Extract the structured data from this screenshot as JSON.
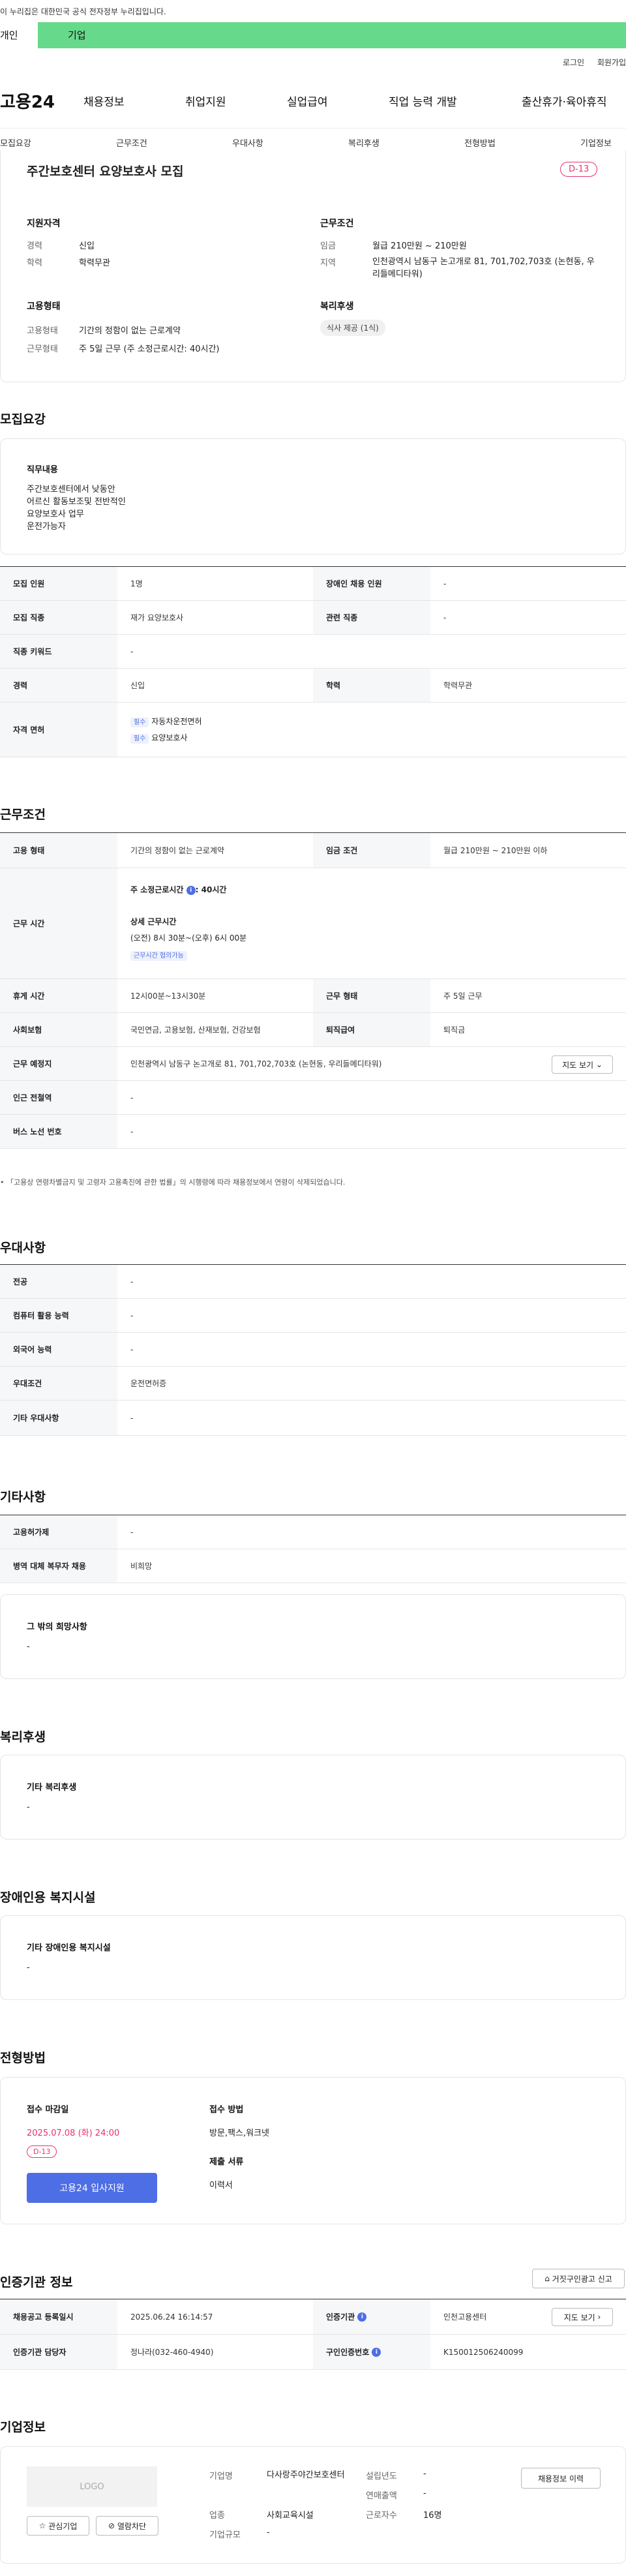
{
  "gov_banner": "이 누리집은 대한민국 공식 전자정부 누리집입니다.",
  "user_tabs": {
    "personal": "개인",
    "company": "기업"
  },
  "top_links": {
    "login": "로그인",
    "join": "회원가입"
  },
  "logo": "고용24",
  "gnb": [
    "채용정보",
    "취업지원",
    "실업급여",
    "직업 능력 개발",
    "출산휴가·육아휴직"
  ],
  "lnb": [
    "모집요강",
    "근무조건",
    "우대사항",
    "복리후생",
    "전형방법",
    "기업정보"
  ],
  "summary": {
    "title": "주간보호센터 요양보호사 모집",
    "dday": "D-13",
    "qual_title": "지원자격",
    "career_label": "경력",
    "career": "신입",
    "edu_label": "학력",
    "edu": "학력무관",
    "emp_title": "고용형태",
    "emp_type_label": "고용형태",
    "emp_type": "기간의 정함이 없는 근로계약",
    "work_type_label": "근무형태",
    "work_type": "주 5일 근무 (주 소정근로시간: 40시간)",
    "cond_title": "근무조건",
    "wage_label": "임금",
    "wage": "월급 210만원 ~ 210만원",
    "region_label": "지역",
    "region": "인천광역시 남동구 논고개로 81, 701,702,703호 (논현동, 우리들메디타워)",
    "welfare_title": "복리후생",
    "welfare_tag": "식사 제공 (1식)"
  },
  "recruit": {
    "section": "모집요강",
    "duty_title": "직무내용",
    "duty_lines": [
      "주간보호센터에서 낮동안",
      "어르신 활동보조및 전반적인",
      "요양보호사 업무",
      "운전가능자"
    ],
    "rows": {
      "headcount_l": "모집 인원",
      "headcount": "1명",
      "disabled_l": "장애인 채용 인원",
      "disabled": "-",
      "job_l": "모집 직종",
      "job": "재가 요양보호사",
      "rel_l": "관련 직종",
      "rel": "-",
      "kw_l": "직종 키워드",
      "kw": "-",
      "career_l": "경력",
      "career": "신입",
      "edu_l": "학력",
      "edu": "학력무관",
      "lic_l": "자격 면허",
      "lic_badge": "필수",
      "lic1": "자동차운전면허",
      "lic2": "요양보호사"
    }
  },
  "conditions": {
    "section": "근무조건",
    "emp_l": "고용 형태",
    "emp": "기간의 정함이 없는 근로계약",
    "wage_l": "임금 조건",
    "wage": "월급 210만원 ~ 210만원 이하",
    "time_l": "근무 시간",
    "weekly": "주 소정근로시간",
    "weekly_v": ": 40시간",
    "detail_t": "상세 근무시간",
    "detail_v": "(오전) 8시 30분~(오후) 6시 00분",
    "flex_badge": "근무시간 협의가능",
    "break_l": "휴게 시간",
    "break": "12시00분~13시30분",
    "form_l": "근무 형태",
    "form": "주 5일 근무",
    "ins_l": "사회보험",
    "ins": "국민연금, 고용보험, 산재보험, 건강보험",
    "ret_l": "퇴직급여",
    "ret": "퇴직금",
    "place_l": "근무 예정지",
    "place": "인천광역시 남동구 논고개로 81, 701,702,703호 (논현동, 우리들메디타워)",
    "map_btn": "지도 보기",
    "subway_l": "인근 전철역",
    "subway": "-",
    "bus_l": "버스 노선 번호",
    "bus": "-",
    "law_note": "「고용상 연령차별금지 및 고령자 고용촉진에 관한 법률」의 시행령에 따라 채용정보에서 연령이 삭제되었습니다."
  },
  "pref": {
    "section": "우대사항",
    "major_l": "전공",
    "major": "-",
    "pc_l": "컴퓨터 활용 능력",
    "pc": "-",
    "lang_l": "외국어 능력",
    "lang": "-",
    "cond_l": "우대조건",
    "cond": "운전면허증",
    "etc_l": "기타 우대사항",
    "etc": "-"
  },
  "etc": {
    "section": "기타사항",
    "probation_l": "고용허가제",
    "probation": "-",
    "mil_l": "병역 대체 복무자 채용",
    "mil": "비희망",
    "hope_t": "그 밖의 희망사항",
    "hope_v": "-"
  },
  "welfare": {
    "section": "복리후생",
    "t": "기타 복리후생",
    "v": "-"
  },
  "facility": {
    "section": "장애인용 복지시설",
    "t": "기타 장애인용 복지시설",
    "v": "-"
  },
  "apply": {
    "section": "전형방법",
    "deadline_t": "접수 마감일",
    "deadline": "2025.07.08 (화) 24:00",
    "dday": "D-13",
    "apply_btn": "고용24 입사지원",
    "method_t": "접수 방법",
    "method": "방문,팩스,워크넷",
    "docs_t": "제출 서류",
    "docs": "이력서"
  },
  "agency": {
    "section": "인증기관 정보",
    "report_btn": "거짓구인광고 신고",
    "reg_l": "채용공고 등록일시",
    "reg": "2025.06.24 16:14:57",
    "org_l": "인증기관",
    "org": "인천고용센터",
    "map_btn": "지도 보기",
    "mgr_l": "인증기관 담당자",
    "mgr": "정나라(032-460-4940)",
    "no_l": "구인인증번호",
    "no": "K150012506240099"
  },
  "company": {
    "section": "기업정보",
    "logo": "LOGO",
    "fav_btn": "관심기업",
    "block_btn": "열람차단",
    "name_l": "기업명",
    "name": "다사랑주야간보호센터",
    "biz_l": "업종",
    "biz": "사회교육시설",
    "size_l": "기업규모",
    "size": "-",
    "year_l": "설립년도",
    "year": "-",
    "sales_l": "연매출액",
    "sales": "-",
    "emp_l": "근로자수",
    "emp": "16명",
    "history_btn": "채용정보 이력"
  }
}
